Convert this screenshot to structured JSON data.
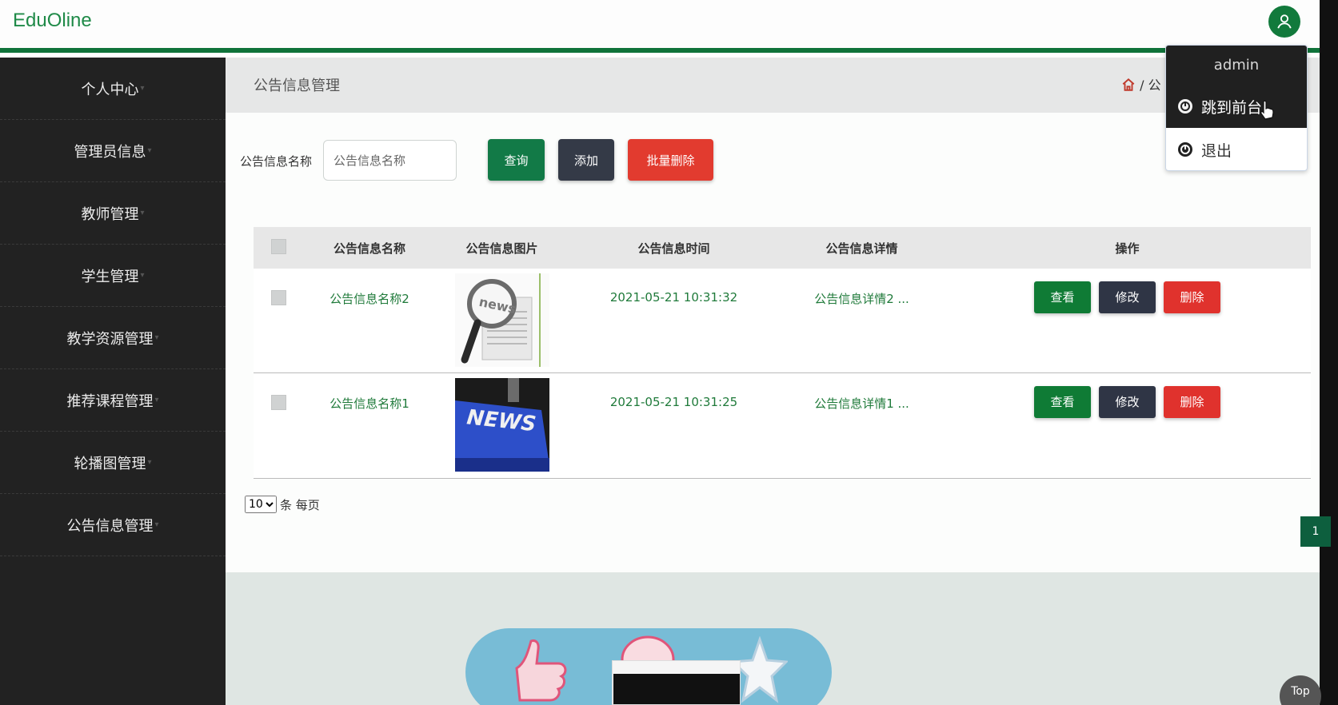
{
  "app": {
    "brand": "EduOline"
  },
  "colors": {
    "accent": "#10733a",
    "sidebar_bg": "#222222",
    "danger": "#e0322d",
    "dark": "#2f3545"
  },
  "sidebar": {
    "items": [
      {
        "label": "个人中心"
      },
      {
        "label": "管理员信息"
      },
      {
        "label": "教师管理"
      },
      {
        "label": "学生管理"
      },
      {
        "label": "教学资源管理"
      },
      {
        "label": "推荐课程管理"
      },
      {
        "label": "轮播图管理"
      },
      {
        "label": "公告信息管理"
      }
    ]
  },
  "page": {
    "title": "公告信息管理",
    "breadcrumb": "/ 公"
  },
  "search": {
    "label": "公告信息名称",
    "placeholder": "公告信息名称",
    "query_label": "查询",
    "add_label": "添加",
    "batch_delete_label": "批量删除"
  },
  "table": {
    "headers": [
      "公告信息名称",
      "公告信息图片",
      "公告信息时间",
      "公告信息详情",
      "操作"
    ],
    "rows": [
      {
        "name": "公告信息名称2",
        "image": "news-magnifier-image",
        "time": "2021-05-21 10:31:32",
        "detail": "公告信息详情2 ...",
        "image_text": "news"
      },
      {
        "name": "公告信息名称1",
        "image": "news-key-image",
        "time": "2021-05-21 10:31:25",
        "detail": "公告信息详情1 ...",
        "image_text": "NEWS"
      }
    ],
    "actions": {
      "view": "查看",
      "edit": "修改",
      "delete": "删除"
    }
  },
  "pagination": {
    "page_size": "10",
    "page_size_suffix": "条 每页",
    "current_page": "1"
  },
  "user_menu": {
    "username": "admin",
    "items": [
      {
        "label": "跳到前台",
        "icon": "power-icon"
      },
      {
        "label": "退出",
        "icon": "power-icon"
      }
    ]
  },
  "top_button": "Top"
}
